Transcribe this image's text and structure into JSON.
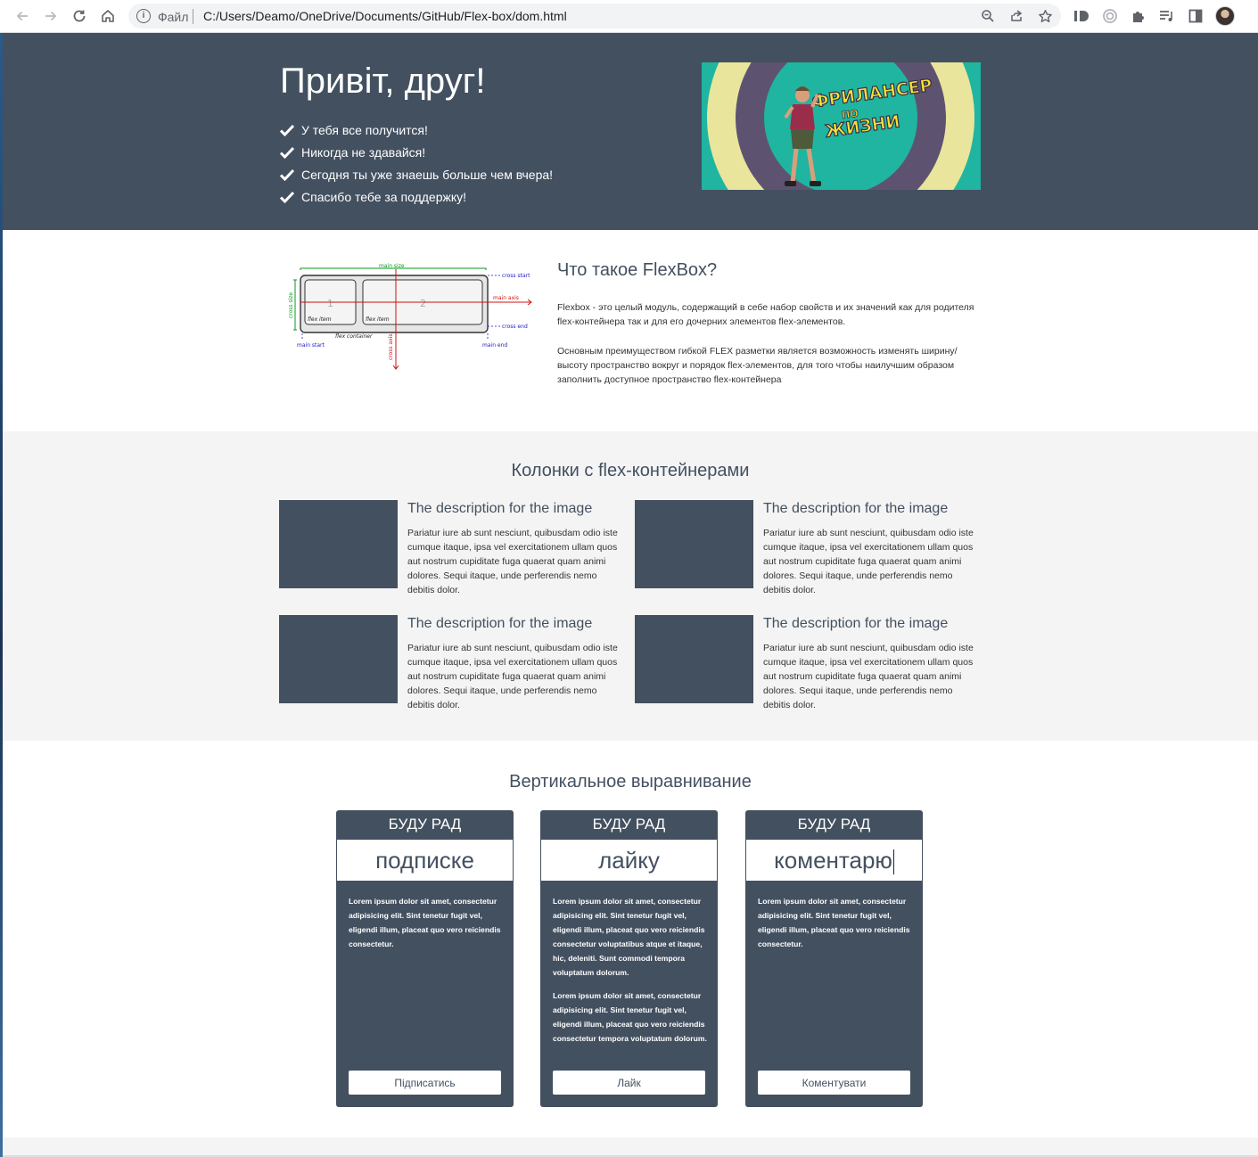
{
  "browser": {
    "file_label": "Файл",
    "url": "C:/Users/Deamo/OneDrive/Documents/GitHub/Flex-box/dom.html"
  },
  "hero": {
    "title": "Привіт, друг!",
    "items": [
      "У тебя все получится!",
      "Никогда не здавайся!",
      "Сегодня ты уже знаешь больше чем вчера!",
      "Спасибо тебе за поддержку!"
    ],
    "banner_text": [
      "ФРИЛАНСЕР",
      "ПО",
      "ЖИЗНИ"
    ]
  },
  "flexbox": {
    "title": "Что такое FlexBox?",
    "paragraphs": [
      "Flexbox - это целый модуль, содержащий в себе набор свойств и их значений как для родителя flex-контейнера так и для его дочерних элементов flex-элементов.",
      "Основным преимуществом гибкой FLEX разметки является возможность изменять ширину/высоту пространство вокруг и порядок flex-элементов, для того чтобы наилучшим образом заполнить доступное пространство flex-контейнера"
    ],
    "diagram_labels": {
      "main_size": "main size",
      "cross_start": "cross start",
      "main_axis": "main axis",
      "cross_end": "cross end",
      "cross_size": "cross size",
      "cross_axis": "cross axis",
      "flex_item": "flex item",
      "flex_container": "flex container",
      "main_start": "main start",
      "main_end": "main end",
      "item_1": "1",
      "item_2": "2"
    }
  },
  "columns": {
    "title": "Колонки с flex-контейнерами",
    "items": [
      {
        "heading": "The description for the image",
        "text": "Pariatur iure ab sunt nesciunt, quibusdam odio iste cumque itaque, ipsa vel exercitationem ullam quos aut nostrum cupiditate fuga quaerat quam animi dolores. Sequi itaque, unde perferendis nemo debitis dolor."
      },
      {
        "heading": "The description for the image",
        "text": "Pariatur iure ab sunt nesciunt, quibusdam odio iste cumque itaque, ipsa vel exercitationem ullam quos aut nostrum cupiditate fuga quaerat quam animi dolores. Sequi itaque, unde perferendis nemo debitis dolor."
      },
      {
        "heading": "The description for the image",
        "text": "Pariatur iure ab sunt nesciunt, quibusdam odio iste cumque itaque, ipsa vel exercitationem ullam quos aut nostrum cupiditate fuga quaerat quam animi dolores. Sequi itaque, unde perferendis nemo debitis dolor."
      },
      {
        "heading": "The description for the image",
        "text": "Pariatur iure ab sunt nesciunt, quibusdam odio iste cumque itaque, ipsa vel exercitationem ullam quos aut nostrum cupiditate fuga quaerat quam animi dolores. Sequi itaque, unde perferendis nemo debitis dolor."
      }
    ]
  },
  "vertical": {
    "title": "Вертикальное выравнивание",
    "cards": [
      {
        "head": "БУДУ РАД",
        "word": "подписке",
        "paragraphs": [
          "Lorem ipsum dolor sit amet, consectetur adipisicing elit. Sint tenetur fugit vel, eligendi illum, placeat quo vero reiciendis consectetur."
        ],
        "button": "Підписатись"
      },
      {
        "head": "БУДУ РАД",
        "word": "лайку",
        "paragraphs": [
          "Lorem ipsum dolor sit amet, consectetur adipisicing elit. Sint tenetur fugit vel, eligendi illum, placeat quo vero reiciendis consectetur voluptatibus atque et itaque, hic, deleniti. Sunt commodi tempora voluptatum dolorum.",
          "Lorem ipsum dolor sit amet, consectetur adipisicing elit. Sint tenetur fugit vel, eligendi illum, placeat quo vero reiciendis consectetur tempora voluptatum dolorum."
        ],
        "button": "Лайк"
      },
      {
        "head": "БУДУ РАД",
        "word": "коментарю",
        "paragraphs": [
          "Lorem ipsum dolor sit amet, consectetur adipisicing elit. Sint tenetur fugit vel, eligendi illum, placeat quo vero reiciendis consectetur."
        ],
        "button": "Коментувати"
      }
    ]
  },
  "colors": {
    "accent": "#435060",
    "section_gray": "#f4f4f4"
  }
}
